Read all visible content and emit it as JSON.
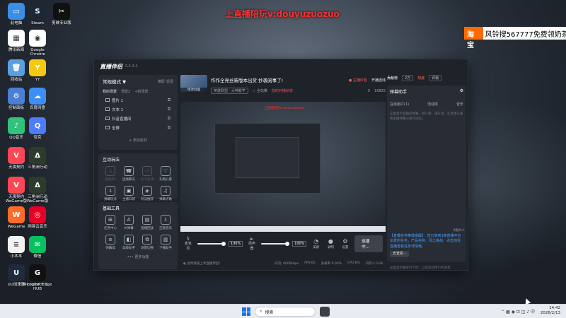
{
  "overlay": {
    "promo": "上直播陪玩v:douyuzuozuo",
    "taobao_label": "淘宝",
    "taobao_text": "风铃搜567777免费领奶茶"
  },
  "desktop_icons": [
    {
      "label": "此电脑",
      "color": "#3a8ee6",
      "glyph": "▭"
    },
    {
      "label": "Steam",
      "color": "#1b2838",
      "glyph": "S"
    },
    {
      "label": "剪映专业版",
      "color": "#111111",
      "glyph": "✂"
    },
    {
      "label": "腾讯新闻",
      "color": "#ffffff",
      "glyph": "▦"
    },
    {
      "label": "Google Chrome",
      "color": "#ffffff",
      "glyph": "◉"
    },
    {
      "label": "回收站",
      "color": "#5aa0e0",
      "glyph": "🗑"
    },
    {
      "label": "YY",
      "color": "#f6c90e",
      "glyph": "Y"
    },
    {
      "label": "控制面板",
      "color": "#4a7fd4",
      "glyph": "⚙"
    },
    {
      "label": "百度网盘",
      "color": "#3e8ef7",
      "glyph": "☁"
    },
    {
      "label": "QQ音乐",
      "color": "#31c27c",
      "glyph": "♪"
    },
    {
      "label": "夸克",
      "color": "#4d7cff",
      "glyph": "Q"
    },
    {
      "label": "无畏契约",
      "color": "#ff4655",
      "glyph": "V"
    },
    {
      "label": "三角洲行动",
      "color": "#2e3b2a",
      "glyph": "Δ"
    },
    {
      "label": "无畏契约 WeGame版",
      "color": "#ff4655",
      "glyph": "V"
    },
    {
      "label": "三角洲行动 WeGame版",
      "color": "#2e3b2a",
      "glyph": "Δ"
    },
    {
      "label": "WeGame",
      "color": "#ff6b2b",
      "glyph": "W"
    },
    {
      "label": "网易云音乐",
      "color": "#e60026",
      "glyph": "◎"
    },
    {
      "label": "小本本",
      "color": "#f2f2f2",
      "glyph": "≡"
    },
    {
      "label": "微信",
      "color": "#07c160",
      "glyph": "✉"
    },
    {
      "label": "UU加速器",
      "color": "#1f2a3a",
      "glyph": "U"
    },
    {
      "label": "Microsoft Edge",
      "color": "#0c77d8",
      "glyph": "e"
    },
    {
      "label": "Logitech G HUB",
      "color": "#111111",
      "glyph": "G"
    }
  ],
  "app": {
    "logo": "直播伴侣",
    "version": "5.5.3.4",
    "sidebar": {
      "mode_title": "常规模式 ▼",
      "mode_opt1": "横屏",
      "mode_opt2": "竖屏",
      "scene_tabs": [
        "我的场景",
        "场景2",
        "+新场景"
      ],
      "sources": [
        {
          "name": "图片 1"
        },
        {
          "name": "文本 1"
        },
        {
          "name": "抖音直播间"
        },
        {
          "name": "全屏"
        }
      ],
      "add_source": "+ 添加素材",
      "interact_title": "互动玩法",
      "interact_tools": [
        {
          "label": "连线PK",
          "glyph": "⚔",
          "dim": true
        },
        {
          "label": "连线聊天",
          "glyph": "☎",
          "dim": false
        },
        {
          "label": "多人连线",
          "glyph": "⚇",
          "dim": true
        },
        {
          "label": "礼物心愿",
          "glyph": "♡",
          "dim": false
        },
        {
          "label": "弹幕玩法",
          "glyph": "⇩",
          "dim": false
        },
        {
          "label": "主播口袋",
          "glyph": "▣",
          "dim": false
        },
        {
          "label": "玩法推荐",
          "glyph": "◈",
          "dim": false
        },
        {
          "label": "弹幕点歌",
          "glyph": "♫",
          "dim": false
        }
      ],
      "basic_title": "基础工具",
      "basic_tools": [
        {
          "label": "任务中心",
          "glyph": "⊞"
        },
        {
          "label": "AI弹幕",
          "glyph": "A"
        },
        {
          "label": "直播回放",
          "glyph": "▤"
        },
        {
          "label": "正版音乐",
          "glyph": "⇩"
        },
        {
          "label": "弹幕墙",
          "glyph": "≡"
        },
        {
          "label": "高级助手",
          "glyph": "◧"
        },
        {
          "label": "场景切换",
          "glyph": "⧉"
        },
        {
          "label": "下播助手",
          "glyph": "▥"
        }
      ],
      "more": "••• 更多功能"
    },
    "center": {
      "cover_label": "修改封面",
      "title": "作作全亮丝新版本出货 抄袭阅事了!",
      "tag": "英雄联盟 · 大神教学",
      "pin": "☆ 全站推",
      "live_status": "您的开播状态",
      "stats_likes": "0",
      "stats_views": "16825",
      "start_pk": "开播连线",
      "danger": "● 主播红包",
      "mic_label": "麦克风",
      "speaker_label": "扬声器",
      "vol1": "100%",
      "vol2": "100%",
      "tools": [
        {
          "label": "美颜",
          "glyph": "◔"
        },
        {
          "label": "录制",
          "glyph": "●"
        },
        {
          "label": "设置",
          "glyph": "⚙"
        }
      ],
      "go_live": "连播中...",
      "status_tip": "◐ 此时快速上手直播伴侣!",
      "status_items": [
        "码流: 6000kbps",
        "FPS:60",
        "丢帧率:0.00%",
        "CPU:8%",
        "内存:2.1GB"
      ]
    },
    "right": {
      "tabs": [
        "贡献榜",
        "2万",
        "热度",
        "评级"
      ],
      "panel_title": "弹幕助手",
      "sub_tabs": [
        "在线用户(1)",
        "活动库",
        "音乐"
      ],
      "hint": "这里显示直播间弹幕，如礼物、送礼等，在此便于查看主播弹幕与观众动态。",
      "gift_line": "0观众人",
      "task_msg": "【直播任务推荐提醒】：您已收到1条直播平台派发的任务，产品名称：风之挑战，点击前往直播查看任务详情哦。",
      "task_view": "去查看 ›",
      "bottom_hint": "这里显示最近打下你，以及连续用户的消息"
    }
  },
  "taskbar": {
    "search": "搜索",
    "tray": "⌃ ▦ ◉ ⊡ ◫ ♪ 中",
    "time": "14:42",
    "date": "2026/2/13"
  }
}
